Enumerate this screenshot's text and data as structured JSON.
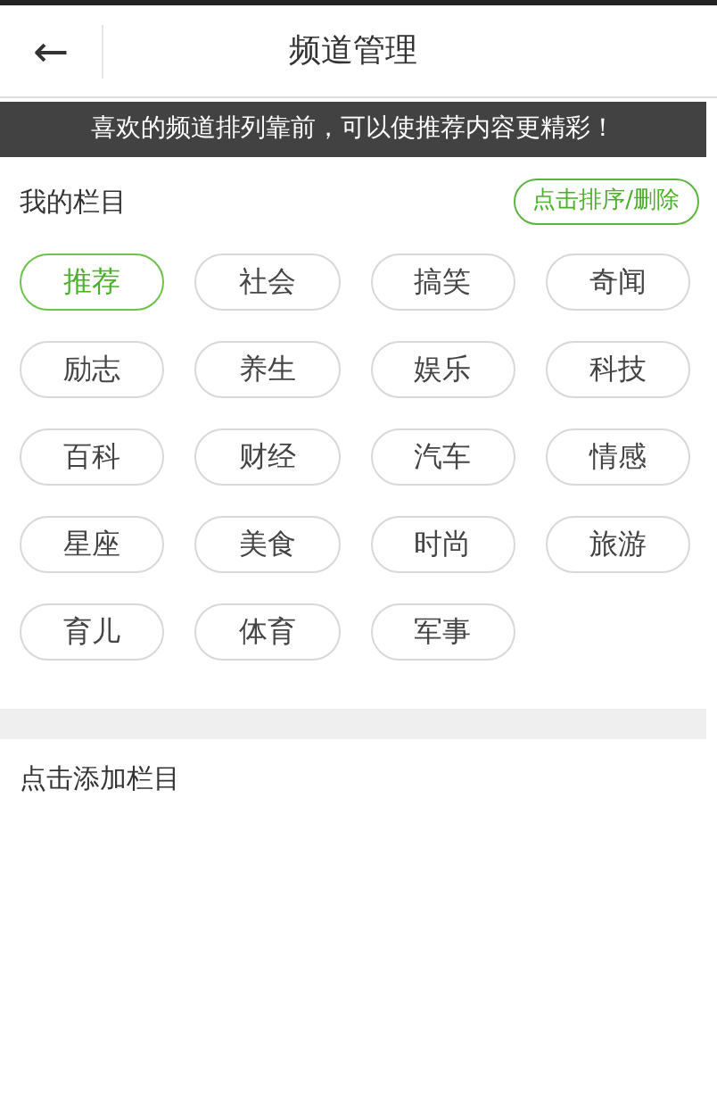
{
  "header": {
    "back": "←",
    "title": "频道管理"
  },
  "banner": "喜欢的频道排列靠前，可以使推荐内容更精彩！",
  "my_channels": {
    "title": "我的栏目",
    "action": "点击排序/删除",
    "items": [
      {
        "label": "推荐",
        "selected": true
      },
      {
        "label": "社会",
        "selected": false
      },
      {
        "label": "搞笑",
        "selected": false
      },
      {
        "label": "奇闻",
        "selected": false
      },
      {
        "label": "励志",
        "selected": false
      },
      {
        "label": "养生",
        "selected": false
      },
      {
        "label": "娱乐",
        "selected": false
      },
      {
        "label": "科技",
        "selected": false
      },
      {
        "label": "百科",
        "selected": false
      },
      {
        "label": "财经",
        "selected": false
      },
      {
        "label": "汽车",
        "selected": false
      },
      {
        "label": "情感",
        "selected": false
      },
      {
        "label": "星座",
        "selected": false
      },
      {
        "label": "美食",
        "selected": false
      },
      {
        "label": "时尚",
        "selected": false
      },
      {
        "label": "旅游",
        "selected": false
      },
      {
        "label": "育儿",
        "selected": false
      },
      {
        "label": "体育",
        "selected": false
      },
      {
        "label": "军事",
        "selected": false
      }
    ]
  },
  "add_section": {
    "title": "点击添加栏目"
  }
}
